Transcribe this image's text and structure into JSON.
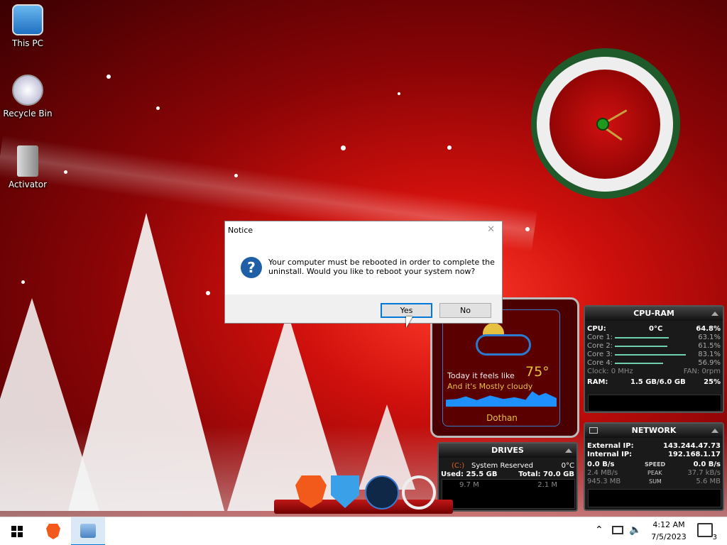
{
  "desktop": {
    "icons": [
      {
        "label": "This PC",
        "icon": "computer-icon"
      },
      {
        "label": "Recycle Bin",
        "icon": "recycle-bin-icon"
      },
      {
        "label": "Activator",
        "icon": "activator-icon"
      }
    ]
  },
  "dialog": {
    "title": "Notice",
    "message": "Your computer must be rebooted in order to complete the uninstall. Would you like to reboot your system now?",
    "icon": "question-icon",
    "yes_label": "Yes",
    "no_label": "No"
  },
  "cpu_ram": {
    "title": "CPU-RAM",
    "cpu_label": "CPU:",
    "cpu_temp": "0°C",
    "cpu_pct": "64.8%",
    "cores": [
      {
        "label": "Core 1:",
        "value": "63.1%"
      },
      {
        "label": "Core 2:",
        "value": "61.5%"
      },
      {
        "label": "Core 3:",
        "value": "83.1%"
      },
      {
        "label": "Core 4:",
        "value": "56.9%"
      }
    ],
    "clock": "Clock: 0 MHz",
    "fan": "FAN: 0rpm",
    "ram_label": "RAM:",
    "ram_usage": "1.5 GB/6.0 GB",
    "ram_pct": "25%"
  },
  "network": {
    "title": "NETWORK",
    "external_label": "External IP:",
    "external_ip": "143.244.47.73",
    "internal_label": "Internal IP:",
    "internal_ip": "192.168.1.17",
    "down_speed": "0.0 B/s",
    "speed_label": "SPEED",
    "up_speed": "0.0 B/s",
    "down_peak": "2.4 MB/s",
    "peak_label": "PEAK",
    "up_peak": "37.7 kB/s",
    "down_sum": "945.3 MB",
    "sum_label": "SUM",
    "up_sum": "5.6 MB"
  },
  "drives": {
    "title": "DRIVES",
    "drive_letter": "(C:)",
    "drive_name": "System Reserved",
    "drive_temp": "0°C",
    "used": "Used: 25.5 GB",
    "total": "Total: 70.0 GB",
    "read": "9.7 M",
    "write": "2.1 M"
  },
  "weather": {
    "line1": "Today it feels like",
    "temp": "75°",
    "line2": "And it's Mostly cloudy",
    "city": "Dothan"
  },
  "taskbar": {
    "time": "4:12 AM",
    "date": "7/5/2023",
    "notification_count": "3"
  },
  "colors": {
    "accent": "#0078d7",
    "question_icon": "#1e5fa8",
    "widget_bg": "#1a1a1a",
    "graph_line": "#6fd0b0"
  }
}
